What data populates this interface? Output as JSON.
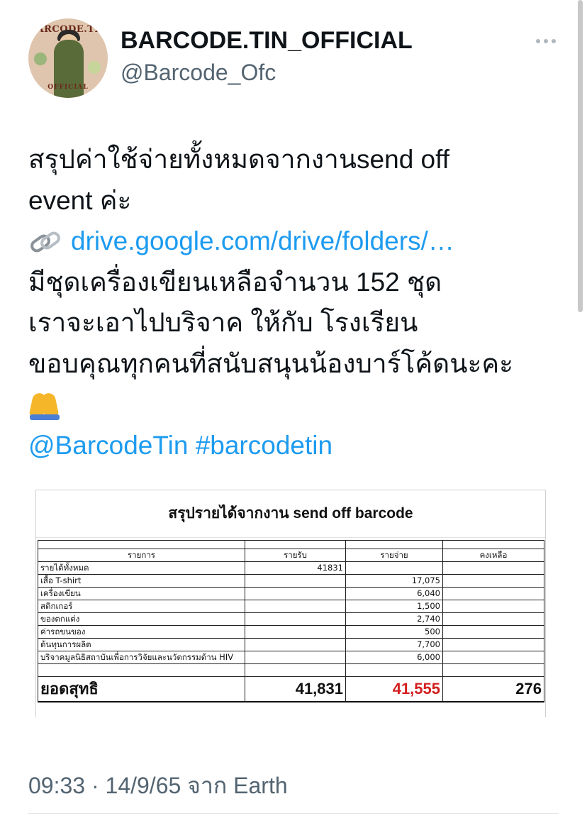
{
  "author": {
    "display_name": "BARCODE.TIN_OFFICIAL",
    "handle": "@Barcode_Ofc",
    "avatar_text_top": "BARCODE.TIN",
    "avatar_text_bottom": "OFFICIAL"
  },
  "tweet": {
    "line1": "สรุปค่าใช้จ่ายทั้งหมดจากงานsend off",
    "line2": "event ค่ะ",
    "link_icon": "link-icon",
    "link_text": "drive.google.com/drive/folders/…",
    "line4": "มีชุดเครื่องเขียนเหลือจำนวน 152 ชุด",
    "line5": "เราจะเอาไปบริจาค ให้กับ โรงเรียน",
    "line6": "ขอบคุณทุกคนที่สนับสนุนน้องบาร์โค้ดนะคะ",
    "emoji": "folded-hands-icon",
    "mention": "@BarcodeTin",
    "hashtag": "#barcodetin"
  },
  "sheet": {
    "title": "สรุปรายได้จากงาน send off barcode",
    "headers": [
      "รายการ",
      "รายรับ",
      "รายจ่าย",
      "คงเหลือ"
    ],
    "rows": [
      {
        "item": "รายได้ทั้งหมด",
        "income": "41831",
        "expense": "",
        "balance": ""
      },
      {
        "item": "เสื้อ T-shirt",
        "income": "",
        "expense": "17,075",
        "balance": ""
      },
      {
        "item": "เครื่องเขียน",
        "income": "",
        "expense": "6,040",
        "balance": ""
      },
      {
        "item": "สติกเกอร์",
        "income": "",
        "expense": "1,500",
        "balance": ""
      },
      {
        "item": "ของตกแต่ง",
        "income": "",
        "expense": "2,740",
        "balance": ""
      },
      {
        "item": "ค่ารถขนของ",
        "income": "",
        "expense": "500",
        "balance": ""
      },
      {
        "item": "ต้นทุนการผลิต",
        "income": "",
        "expense": "7,700",
        "balance": ""
      },
      {
        "item": "บริจาคมูลนิธิสถาบันเพื่อการวิจัยและนวัตกรรมด้าน HIV",
        "income": "",
        "expense": "6,000",
        "balance": ""
      }
    ],
    "total": {
      "label": "ยอดสุทธิ",
      "income": "41,831",
      "expense": "41,555",
      "balance": "276"
    },
    "expense_color": "#d32020"
  },
  "timestamp": "09:33 · 14/9/65 จาก Earth",
  "colors": {
    "link": "#1d9bf0",
    "secondary_text": "#536471"
  }
}
